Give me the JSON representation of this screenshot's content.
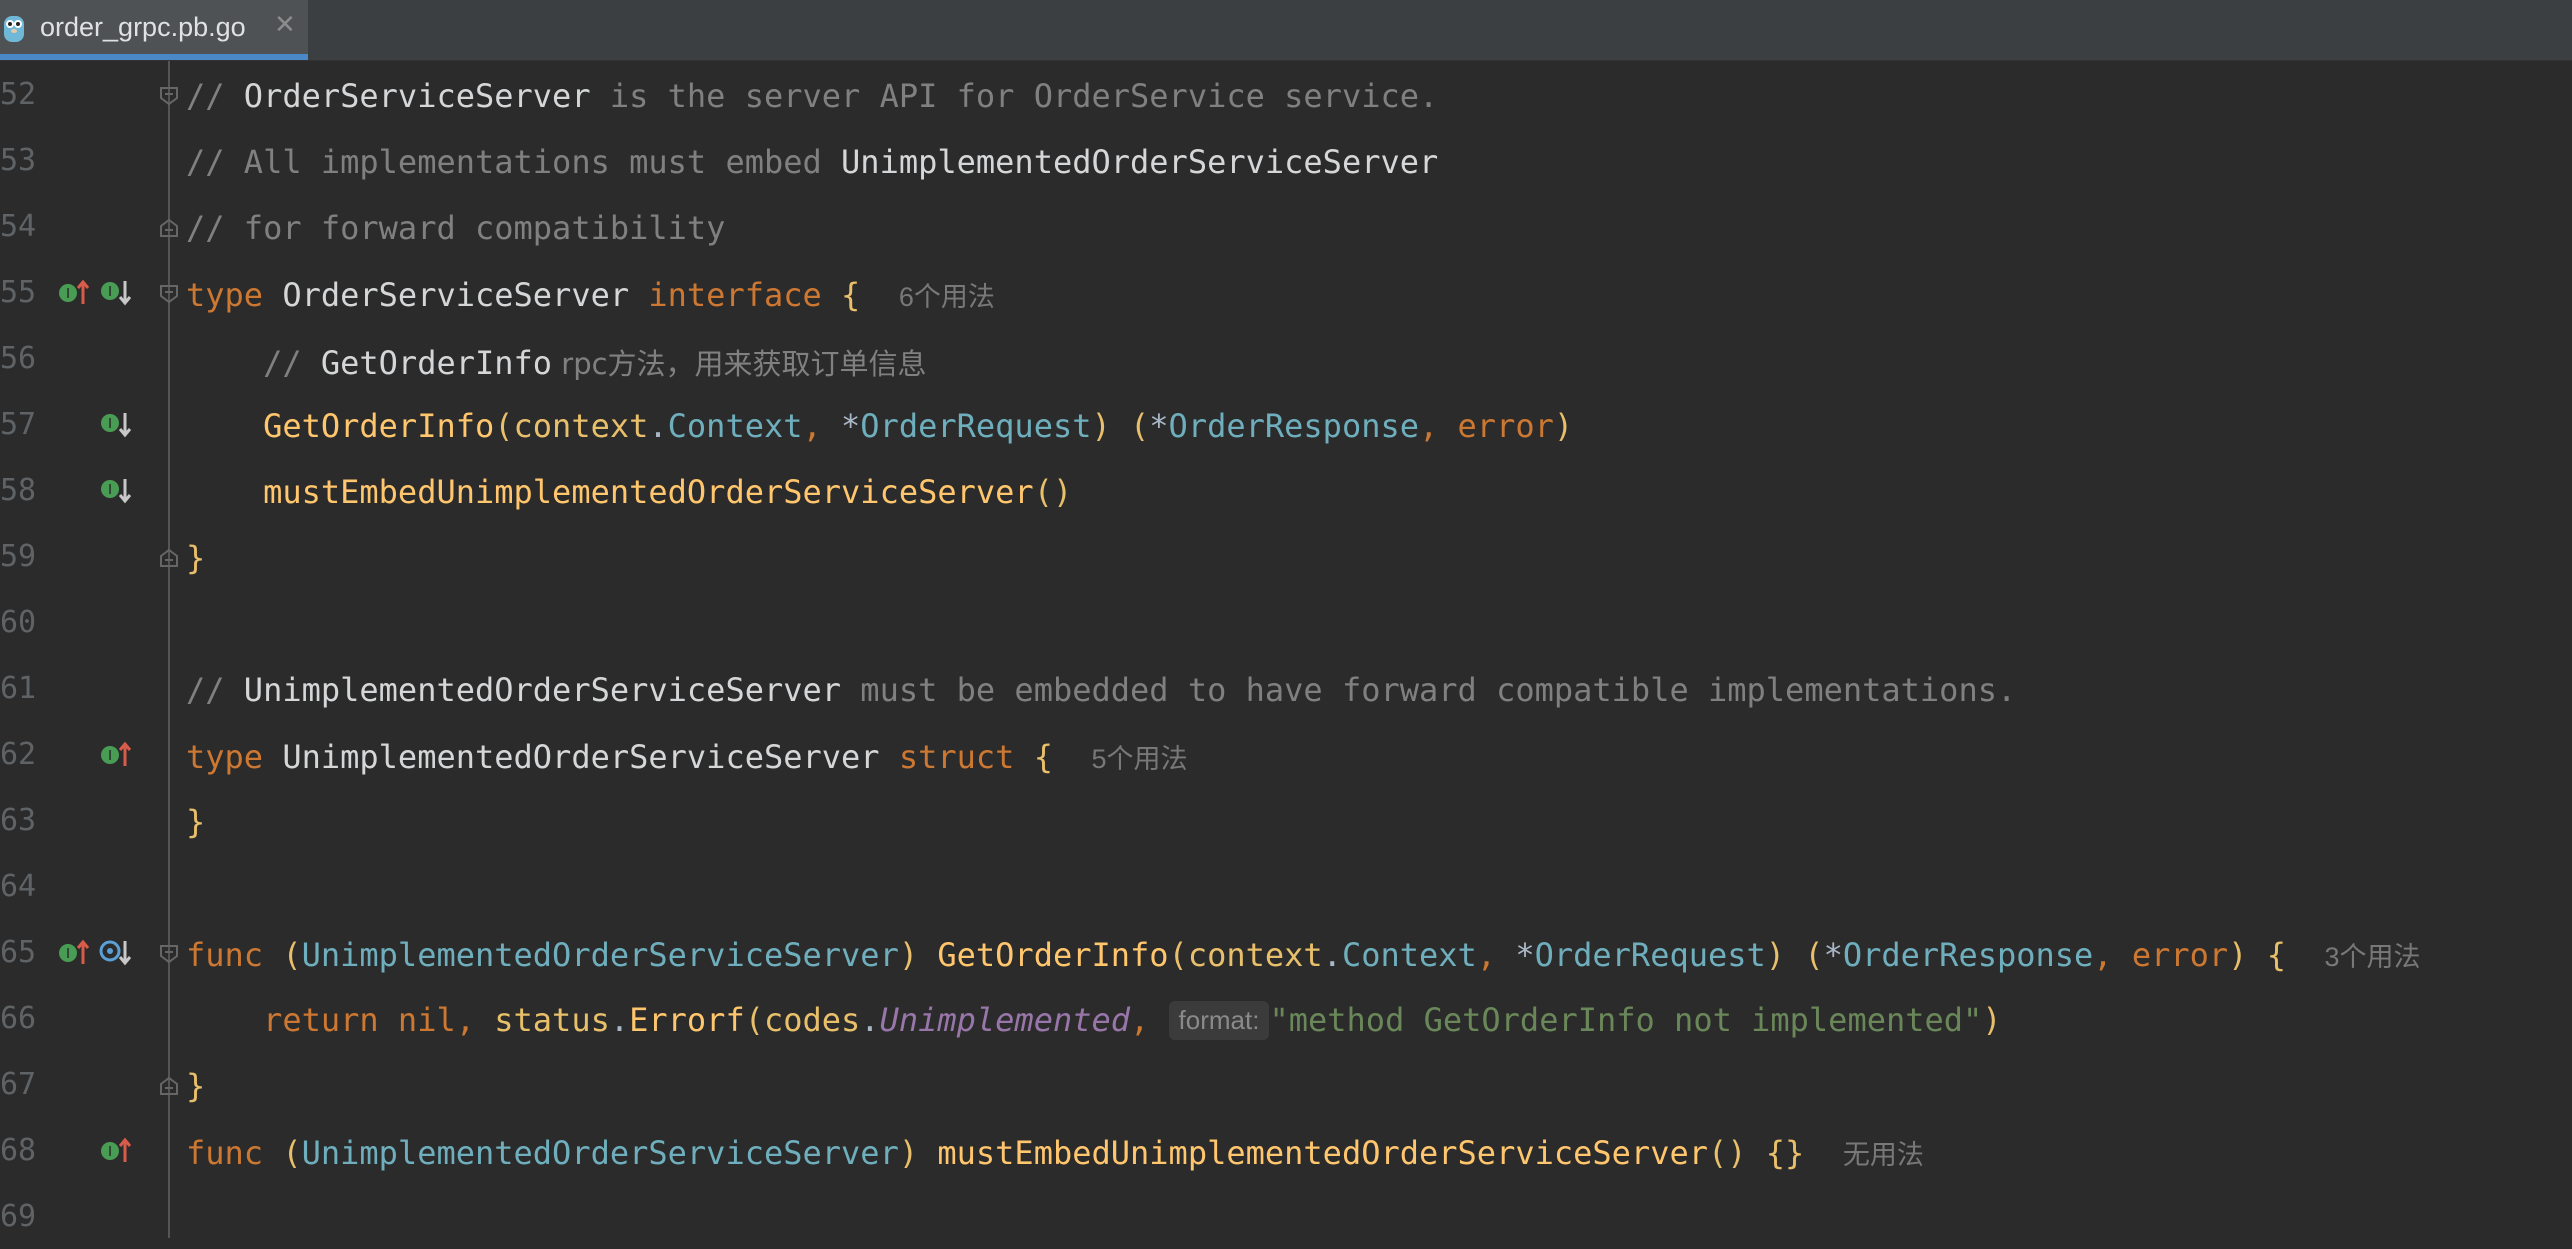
{
  "tab": {
    "title": "order_grpc.pb.go",
    "close": "✕"
  },
  "lines": [
    {
      "no": "52",
      "code": {
        "c1": "// ",
        "t1": "OrderServiceServer",
        "c2": " is the server API for OrderService service."
      }
    },
    {
      "no": "53",
      "code": {
        "c1": "// All implementations must embed ",
        "t1": "UnimplementedOrderServiceServer"
      }
    },
    {
      "no": "54",
      "code": {
        "c1": "// for forward compatibility"
      }
    },
    {
      "no": "55",
      "code": {
        "kw": "type",
        "name": "OrderServiceServer",
        "kw2": "interface",
        "brace": "{",
        "usage": "6个用法"
      }
    },
    {
      "no": "56",
      "code": {
        "c1": "// ",
        "t1": "GetOrderInfo",
        "c2": " rpc方法，用来获取订单信息"
      }
    },
    {
      "no": "57",
      "code": {
        "fn": "GetOrderInfo",
        "p1": "(",
        "a1": "context",
        "dot": ".",
        "a2": "Context",
        "comma": ", ",
        "star": "*",
        "a3": "OrderRequest",
        "p2": ")",
        "p3": " (",
        "star2": "*",
        "a4": "OrderResponse",
        "comma2": ", ",
        "a5": "error",
        "p4": ")"
      }
    },
    {
      "no": "58",
      "code": {
        "fn": "mustEmbedUnimplementedOrderServiceServer",
        "p": "()"
      }
    },
    {
      "no": "59",
      "code": {
        "brace": "}"
      }
    },
    {
      "no": "60",
      "code": {}
    },
    {
      "no": "61",
      "code": {
        "c1": "// ",
        "t1": "UnimplementedOrderServiceServer",
        "c2": " must be embedded to have forward compatible implementations."
      }
    },
    {
      "no": "62",
      "code": {
        "kw": "type",
        "name": "UnimplementedOrderServiceServer",
        "kw2": "struct",
        "brace": "{",
        "usage": "5个用法"
      }
    },
    {
      "no": "63",
      "code": {
        "brace": "}"
      }
    },
    {
      "no": "64",
      "code": {}
    },
    {
      "no": "65",
      "code": {
        "kw": "func",
        "p1": " (",
        "recv": "UnimplementedOrderServiceServer",
        "p2": ") ",
        "fn": "GetOrderInfo",
        "p3": "(",
        "a1": "context",
        "dot": ".",
        "a2": "Context",
        "comma": ", ",
        "star": "*",
        "a3": "OrderRequest",
        "p4": ")",
        "p5": " (",
        "star2": "*",
        "a4": "OrderResponse",
        "comma2": ", ",
        "a5": "error",
        "p6": ")",
        "brace": " {",
        "usage": "3个用法"
      }
    },
    {
      "no": "66",
      "code": {
        "kw": "return",
        "sp": " ",
        "nil": "nil",
        "comma": ", ",
        "pkg": "status",
        "dot": ".",
        "fn": "Errorf",
        "p1": "(",
        "pkg2": "codes",
        "dot2": ".",
        "const": "Unimplemented",
        "comma2": ", ",
        "hint": "format:",
        "str": "\"method GetOrderInfo not implemented\"",
        "p2": ")"
      }
    },
    {
      "no": "67",
      "code": {
        "brace": "}"
      }
    },
    {
      "no": "68",
      "code": {
        "kw": "func",
        "p1": " (",
        "recv": "UnimplementedOrderServiceServer",
        "p2": ") ",
        "fn": "mustEmbedUnimplementedOrderServiceServer",
        "p3": "()",
        "brace": " {}",
        "usage": "无用法"
      }
    },
    {
      "no": "69",
      "code": {}
    }
  ],
  "colors": {
    "background": "#2b2b2b",
    "comment": "#808080",
    "keyword": "#cc7832",
    "function": "#ffc66d",
    "type_ref": "#6fafbd",
    "string": "#6a8759",
    "constant": "#9876aa"
  },
  "icons": {
    "gopher": "gopher-file-icon",
    "implemented": "implemented-arrow-up-icon",
    "implementing": "implementing-arrow-down-icon",
    "fold": "fold-marker-icon"
  }
}
